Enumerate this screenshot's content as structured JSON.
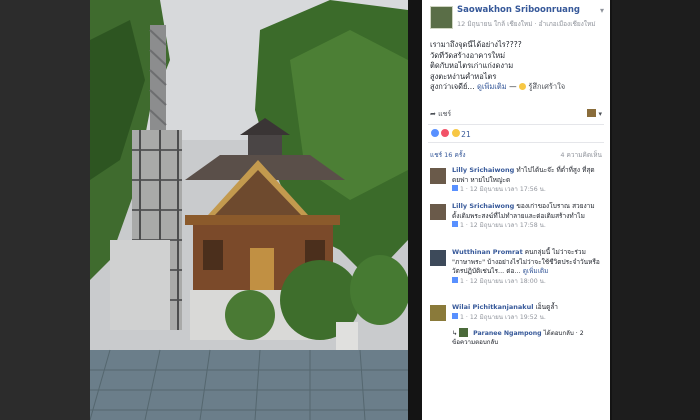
{
  "post": {
    "author": "Saowakhon Sriboonruang",
    "meta": "12 มิถุนายน ใกล้ เชียงใหม่ · อำเภอเมืองเชียงใหม่",
    "body_lines": [
      "เรามาถึงจุดนี้ได้อย่างไร????",
      "วัดที่วัดสร้างอาคารใหม่",
      "ติดกับหอไตรเก่าแก่งดงาม",
      "สูงตะหง่านค้ำหอไตร",
      "สูงกว่าเจดีย์..."
    ],
    "see_more": "ดูเพิ่มเติม",
    "feeling": "รู้สึกเศร้าใจ",
    "share_label": "แชร์",
    "reaction_count": "21",
    "shares": "แชร์ 16 ครั้ง",
    "comment_count": "4 ความคิดเห็น"
  },
  "comments": [
    {
      "name": "Lilly Srichaiwong",
      "text": "ทำไปได้นะจ๊ะ ที่ต่ำที่สูง ที่สุดดยฟา หายไปใหญ่ะด",
      "likes": "1",
      "time": "12 มิถุนายน เวลา 17:56 น."
    },
    {
      "name": "Lilly Srichaiwong",
      "text": "ของเก่าของโบราณ สวยงามดั้งเดิมพระสงฆ์ที่ไม่ทำลายและต่อเติมสร้างทำไม",
      "likes": "1",
      "time": "12 มิถุนายน เวลา 17:58 น."
    },
    {
      "name": "Wutthinan Promrat",
      "text": "คนกลุ่มนี้ ไม่ว่าจะร่วม \"ภาษาพระ\" บ้างอย่างไรไม่ว่าจะใช้ชีวิตประจำวันหรือวัตรปฏิบัติเช่นไร... ต่อ...",
      "more": "ดูเพิ่มเติม",
      "likes": "1",
      "time": "12 มิถุนายน เวลา 18:00 น."
    },
    {
      "name": "Wilai Pichitkanjanakul",
      "text": "เอ็นดูล้ำ",
      "likes": "1",
      "time": "12 มิถุนายน เวลา 19:52 น."
    }
  ],
  "reply": {
    "name": "Paranee Ngampong",
    "text": "ได้ตอบกลับ · 2 ข้อความตอบกลับ"
  },
  "colors": {
    "link": "#365899",
    "like_blue": "#5890ff",
    "love_red": "#f25268",
    "haha_yellow": "#f7c744"
  }
}
